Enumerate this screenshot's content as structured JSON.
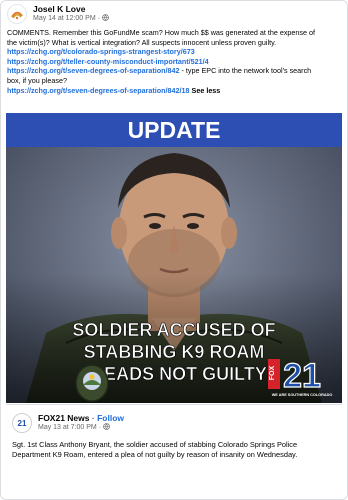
{
  "post": {
    "author": "Josel K Love",
    "timestamp": "May 14 at 12:00 PM",
    "separator": "·",
    "text_lines": [
      "COMMENTS.  Remember this GoFundMe scam?  How much $$ was generated at the expense of",
      "the victim(s)?  What is vertical integration?  All suspects innocent unless proven guilty."
    ],
    "links": [
      "https://zchg.org/t/colorado-springs-strangest-story/673",
      "https://zchg.org/t/teller-county-misconduct-important/521/4"
    ],
    "link3": "https://zchg.org/t/seven-degrees-of-separation/842",
    "link3_suffix": " - type EPC into the network tool's search",
    "link3_suffix_line2": "box, if you please?",
    "link4": "https://zchg.org/t/seven-degrees-of-separation/842/18",
    "see_less": "See less"
  },
  "media": {
    "banner": "UPDATE",
    "headline_lines": [
      "SOLDIER ACCUSED OF",
      "STABBING K9 ROAM",
      "PLEADS NOT GUILTY"
    ],
    "station_logo_fox": "FOX",
    "station_logo_num": "21",
    "station_tagline": "WE ARE SOUTHERN COLORADO"
  },
  "shared_post": {
    "page_name": "FOX21 News",
    "follow_label": "Follow",
    "timestamp": "May 13 at 7:00 PM",
    "avatar_text": "21",
    "text_lines": [
      "Sgt. 1st Class Anthony Bryant, the soldier accused of stabbing Colorado Springs Police",
      "Department K9 Roam, entered a plea of not guilty by reason of insanity on Wednesday."
    ]
  },
  "colors": {
    "link": "#216fdb",
    "banner_bg": "#2d4fb4",
    "fox_red": "#d6232a",
    "fox_blue": "#1e4fa8"
  }
}
